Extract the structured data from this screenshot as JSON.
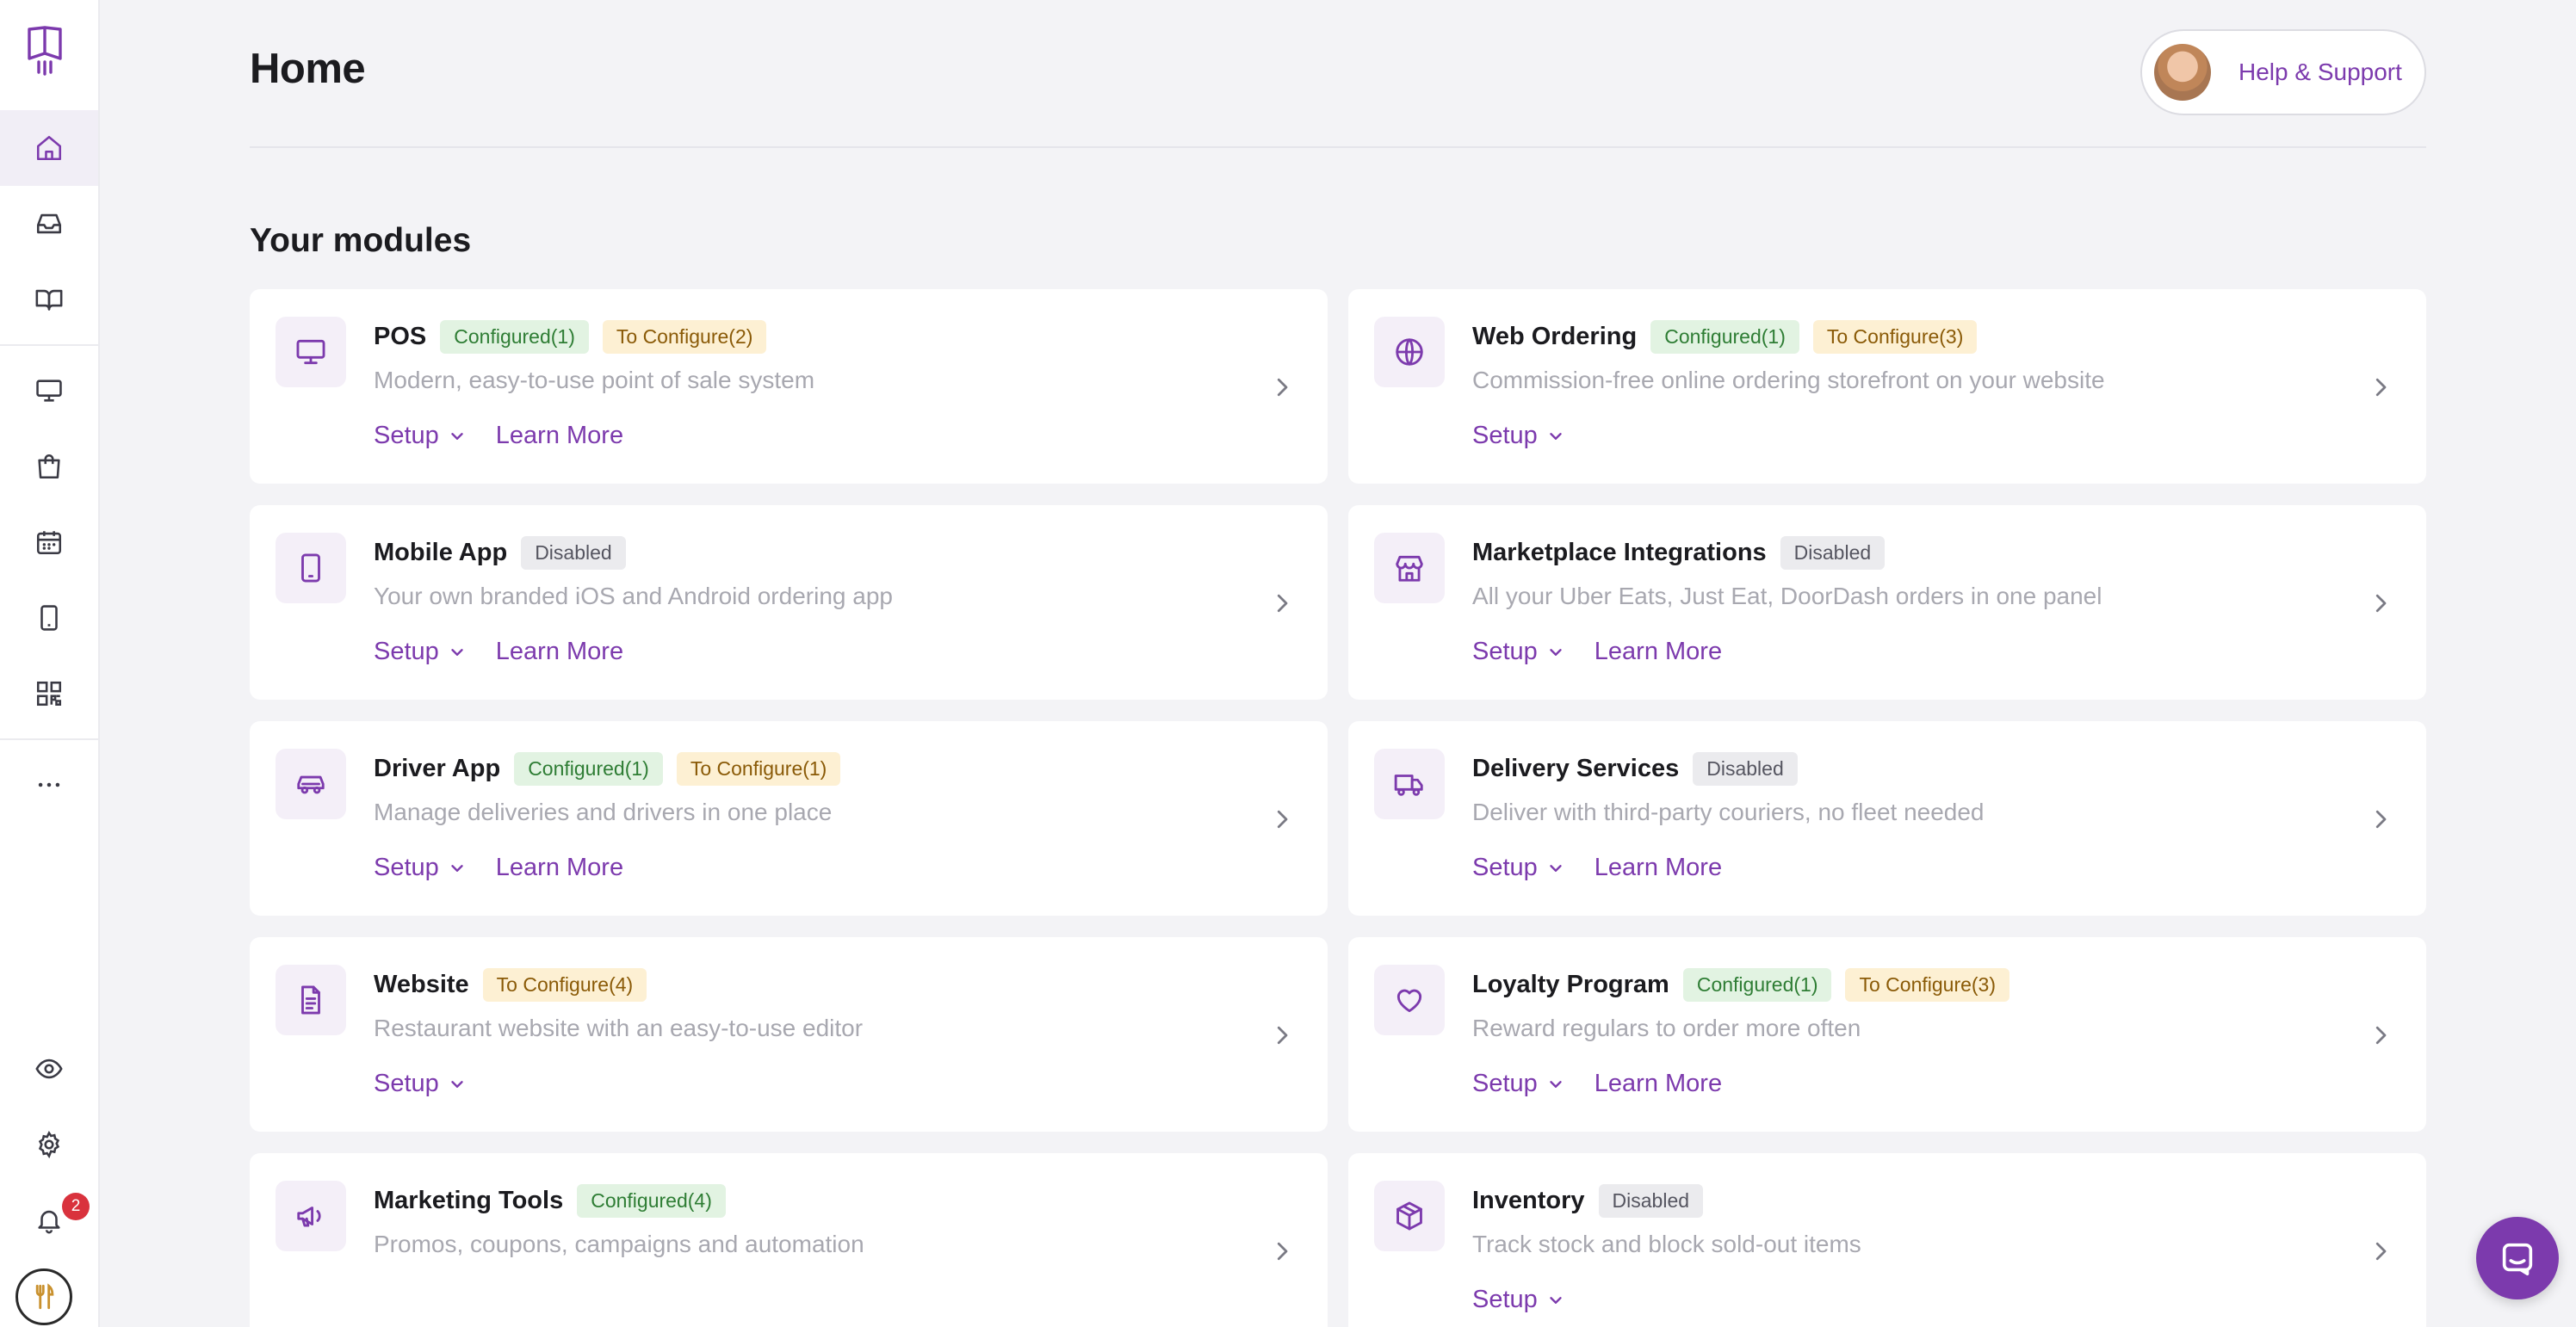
{
  "header": {
    "title": "Home",
    "help_label": "Help & Support"
  },
  "section_title": "Your modules",
  "notifications": {
    "count": "2"
  },
  "colors": {
    "accent": "#7c3aad",
    "configured": "#2e7d34",
    "to_configure": "#8a5a07",
    "badge": "#d9323d"
  },
  "sidebar": {
    "items": [
      {
        "name": "home-icon",
        "active": true
      },
      {
        "name": "inbox-icon"
      },
      {
        "name": "book-open-icon"
      },
      {
        "name": "monitor-icon"
      },
      {
        "name": "shopping-bag-icon"
      },
      {
        "name": "calendar-icon"
      },
      {
        "name": "smartphone-icon"
      },
      {
        "name": "qr-code-icon"
      },
      {
        "name": "more-icon"
      },
      {
        "name": "eye-icon"
      },
      {
        "name": "settings-icon"
      },
      {
        "name": "bell-icon"
      }
    ]
  },
  "modules": [
    {
      "name": "POS",
      "configured": "Configured(1)",
      "to_configure": "To Configure(2)",
      "desc": "Modern, easy-to-use point of sale system",
      "setup": "Setup",
      "learn": "Learn More",
      "icon": "monitor-icon"
    },
    {
      "name": "Web Ordering",
      "configured": "Configured(1)",
      "to_configure": "To Configure(3)",
      "desc": "Commission-free online ordering storefront on your website",
      "setup": "Setup",
      "icon": "globe-icon"
    },
    {
      "name": "Mobile App",
      "disabled": "Disabled",
      "desc": "Your own branded iOS and Android ordering app",
      "setup": "Setup",
      "learn": "Learn More",
      "icon": "smartphone-icon"
    },
    {
      "name": "Marketplace Integrations",
      "disabled": "Disabled",
      "desc": "All your Uber Eats, Just Eat, DoorDash orders in one panel",
      "setup": "Setup",
      "learn": "Learn More",
      "icon": "store-icon"
    },
    {
      "name": "Driver App",
      "configured": "Configured(1)",
      "to_configure": "To Configure(1)",
      "desc": "Manage deliveries and drivers in one place",
      "setup": "Setup",
      "learn": "Learn More",
      "icon": "car-icon"
    },
    {
      "name": "Delivery Services",
      "disabled": "Disabled",
      "desc": "Deliver with third-party couriers, no fleet needed",
      "setup": "Setup",
      "learn": "Learn More",
      "icon": "truck-icon"
    },
    {
      "name": "Website",
      "to_configure": "To Configure(4)",
      "desc": "Restaurant website with an easy-to-use editor",
      "setup": "Setup",
      "icon": "file-text-icon"
    },
    {
      "name": "Loyalty Program",
      "configured": "Configured(1)",
      "to_configure": "To Configure(3)",
      "desc": "Reward regulars to order more often",
      "setup": "Setup",
      "learn": "Learn More",
      "icon": "heart-icon"
    },
    {
      "name": "Marketing Tools",
      "configured": "Configured(4)",
      "desc": "Promos, coupons, campaigns and automation",
      "icon": "megaphone-icon"
    },
    {
      "name": "Inventory",
      "disabled": "Disabled",
      "desc": "Track stock and block sold-out items",
      "setup": "Setup",
      "icon": "box-icon"
    }
  ]
}
